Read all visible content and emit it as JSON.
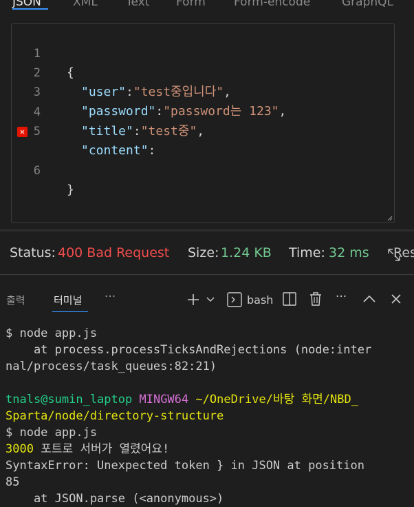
{
  "tabs": [
    "JSON",
    "XML",
    "Text",
    "Form",
    "Form-encode",
    "GraphQL"
  ],
  "editor": {
    "lines": [
      {
        "num": "1",
        "text": "{"
      },
      {
        "num": "2",
        "key": "\"user\"",
        "sep": ":",
        "value": "\"test중입니다\"",
        "tail": ","
      },
      {
        "num": "3",
        "key": "\"password\"",
        "sep": ":",
        "value": "\"password는 123\"",
        "tail": ","
      },
      {
        "num": "4",
        "key": "\"title\"",
        "sep": ":",
        "value": "\"test중\"",
        "tail": ","
      },
      {
        "num": "5",
        "key": "\"content\"",
        "sep": ":"
      },
      {
        "num": "6",
        "text": "}"
      }
    ],
    "error_icon": "error-x-icon"
  },
  "status": {
    "status_label": "Status:",
    "status_value": "400 Bad Request",
    "size_label": "Size:",
    "size_value": "1.24 KB",
    "time_label": "Time:",
    "time_value": "32 ms",
    "response_label": "Resp"
  },
  "panel": {
    "tab_output": "출력",
    "tab_terminal": "터미널",
    "more": "···",
    "shell": "bash"
  },
  "terminal": {
    "l1": "$ node app.js",
    "l2": "    at process.processTicksAndRejections (node:inter",
    "l3": "nal/process/task_queues:82:21)",
    "prompt_user": "tnals@sumin_laptop",
    "prompt_env": "MINGW64",
    "prompt_path_a": "~/OneDrive/바탕 화면/NBD_",
    "prompt_path_b": "Sparta/node/directory-structure",
    "l6": "$ node app.js",
    "port_num": "3000",
    "port_msg": " 포트로 서버가 열렸어요!",
    "l8": "SyntaxError: Unexpected token } in JSON at position",
    "l9": "85",
    "l10": "    at JSON.parse (<anonymous>)"
  },
  "colors": {
    "accent": "#3794ff",
    "error": "#f14c4c",
    "success": "#73c991"
  }
}
